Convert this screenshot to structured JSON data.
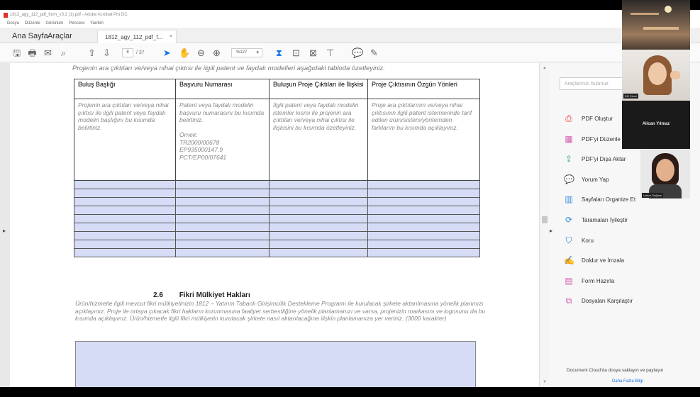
{
  "window": {
    "title": "1812_agy_112_pdf_form_v3.2 (1).pdf - Adobe Acrobat Pro DC",
    "menu": [
      "Dosya",
      "Düzenle",
      "Görünüm",
      "Pencere",
      "Yardım"
    ]
  },
  "tabs": {
    "home": "Ana Sayfa",
    "tools": "Araçlar",
    "document": "1812_agy_112_pdf_f...",
    "close": "×"
  },
  "toolbar": {
    "current_page": "8",
    "total_pages": "/ 37",
    "zoom": "%127"
  },
  "document": {
    "intro": "Projenin ara çıktıları ve/veya nihai çıktısı ile ilgili patent ve faydalı modelleri aşağıdaki tabloda özetleyiniz.",
    "table": {
      "headers": [
        "Buluş Başlığı",
        "Başvuru Numarası",
        "Buluşun Proje Çıktıları ile İlişkisi",
        "Proje Çıktısının Özgün Yönleri"
      ],
      "descriptions": [
        "Projenin ara çıktıları ve/veya nihai çıktısı ile ilgili patent veya faydalı modelin başlığını bu kısımda belirtiniz.",
        "Patent veya faydalı modelin başvuru numarasını bu kısımda belirtiniz.\n\nÖrnek:\nTR2000/00678\nEP935000147.9\nPCT/EP00/07641",
        "İlgili patent veya faydalı modelin istemler kısmı ile projenin ara çıktıları ve/veya nihai çıktısı ile ilişkisini bu kısımda özetleyiniz.",
        "Proje ara çıktılarının ve/veya nihai çıktısının ilgili patent istemlerinde tarif edilen ürün/sistem/yöntemden farklarını bu kısımda açıklayınız."
      ],
      "empty_rows": 9
    },
    "section": {
      "number": "2.6",
      "title": "Fikri Mülkiyet Hakları",
      "text": "Ürün/hizmetle ilgili mevcut fikri mülkiyetinizin 1812 – Yatırım Tabanlı Girişimcilik Destekleme Programı ile kurulacak şirkete aktarılmasına yönelik planınızı açıklayınız. Proje ile ortaya çıkacak fikri hakların korunmasına faaliyet serbestliğine yönelik planlamanızı ve varsa, projenizin markasını ve logosunu da bu kısımda açıklayınız. Ürün/hizmetle ilgili fikri mülkiyetin kurulacak şirkete nasıl aktarılacağına ilişkin planlamanıza yer veriniz. (3000 karakter)"
    }
  },
  "right_pane": {
    "search_placeholder": "Araçlarınızı bulunuz",
    "tools": [
      {
        "name": "pdf-create",
        "label": "PDF Oluştur",
        "icon": "pdf-create-icon",
        "color": "#e0312b"
      },
      {
        "name": "pdf-edit",
        "label": "PDF'yi Düzenle",
        "icon": "pdf-edit-icon",
        "color": "#d35fb0"
      },
      {
        "name": "pdf-export",
        "label": "PDF'yi Dışa Aktar",
        "icon": "pdf-export-icon",
        "color": "#2f9e6e"
      },
      {
        "name": "comment",
        "label": "Yorum Yap",
        "icon": "comment-icon",
        "color": "#f2b53a"
      },
      {
        "name": "organize-pages",
        "label": "Sayfaları Organize Et",
        "icon": "organize-pages-icon",
        "color": "#3a8fd9"
      },
      {
        "name": "enhance-scans",
        "label": "Taramaları İyileştir",
        "icon": "enhance-scans-icon",
        "color": "#3a8fd9"
      },
      {
        "name": "protect",
        "label": "Koru",
        "icon": "shield-icon",
        "color": "#3a6fd9"
      },
      {
        "name": "fill-sign",
        "label": "Doldur ve İmzala",
        "icon": "fill-sign-icon",
        "color": "#7b5fc9"
      },
      {
        "name": "prepare-form",
        "label": "Form Hazırla",
        "icon": "prepare-form-icon",
        "color": "#d35fb0"
      },
      {
        "name": "compare-files",
        "label": "Dosyaları Karşılaştır",
        "icon": "compare-files-icon",
        "color": "#d35fb0"
      }
    ],
    "cloud_text": "Document Cloud'da dosya saklayın ve paylaşın",
    "cloud_link": "Daha Fazla Bilgi"
  },
  "video": {
    "participant_2": "Elif Güzel",
    "participant_3": "Alican Yılmaz",
    "participant_4": "Hatice Sağlam"
  }
}
